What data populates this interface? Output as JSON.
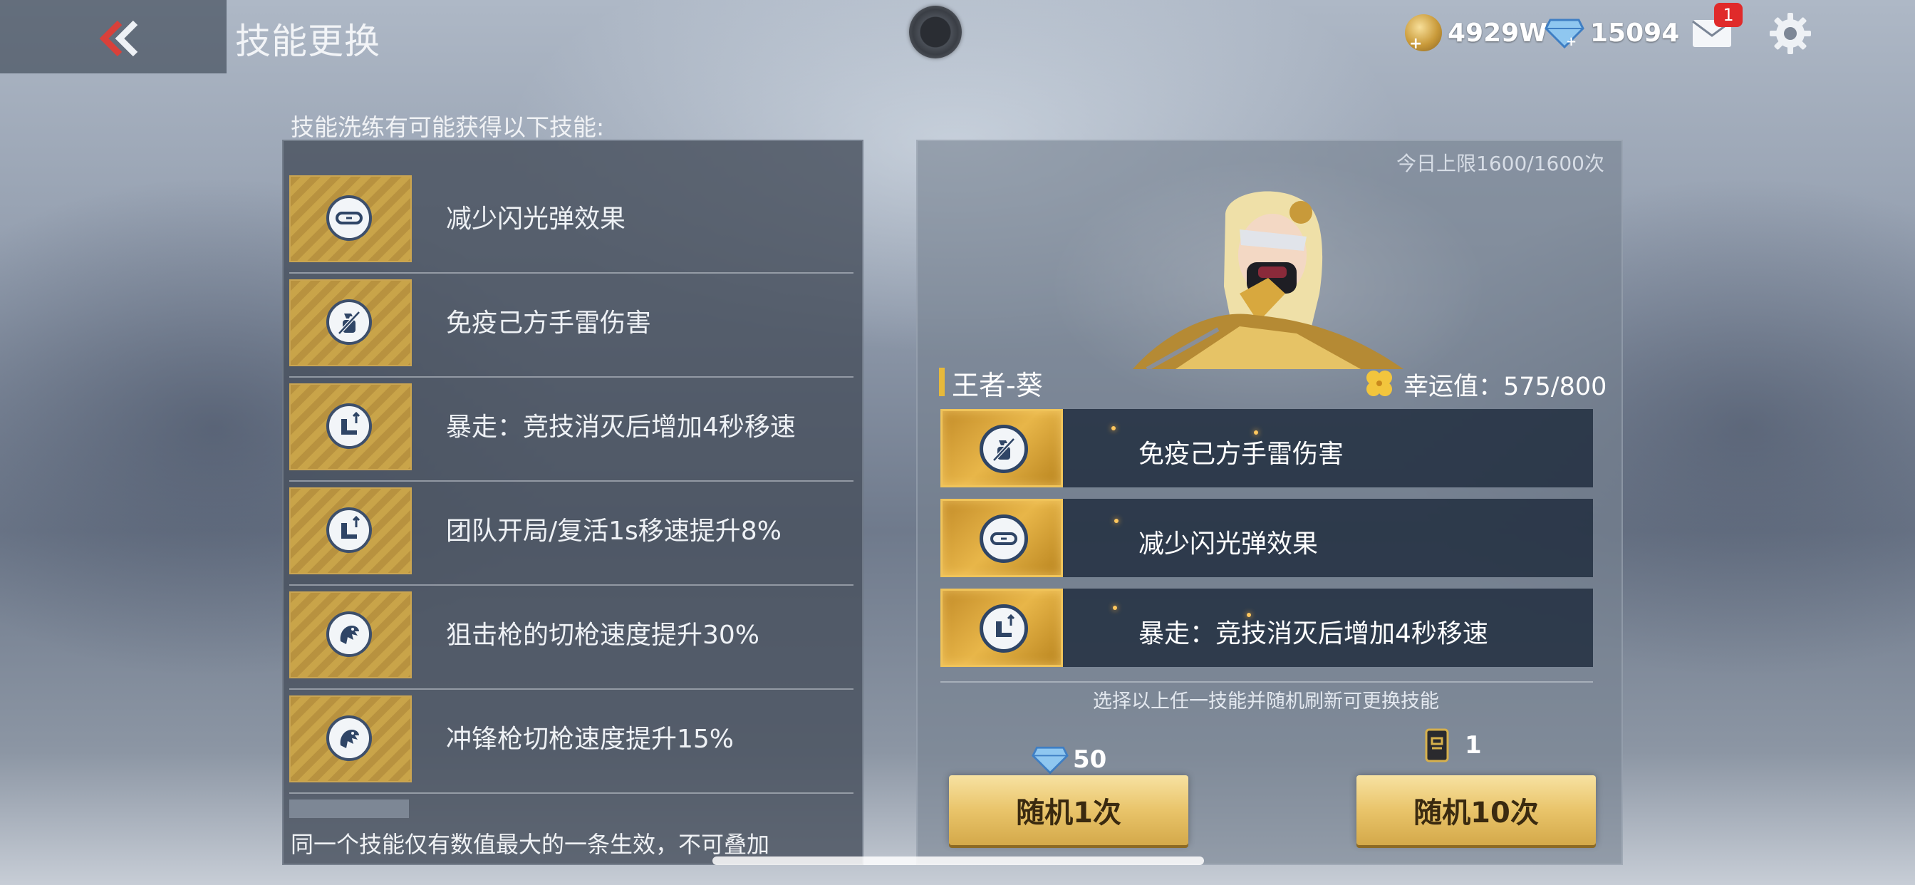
{
  "header": {
    "title": "技能更换",
    "back_icon": "chevron-left-icon",
    "currencies": [
      {
        "name": "gold-coin-icon",
        "value": "4929W"
      },
      {
        "name": "diamond-icon",
        "value": "15094"
      }
    ],
    "mail_badge": "1",
    "accent": "#e7b93a"
  },
  "left": {
    "caption": "技能洗练有可能获得以下技能:",
    "skills": [
      {
        "label": "减少闪光弹效果",
        "icon": "goggles-icon"
      },
      {
        "label": "免疫己方手雷伤害",
        "icon": "grenade-immune-icon"
      },
      {
        "label": "暴走：竞技消灭后增加4秒移速",
        "icon": "boot-speed-icon"
      },
      {
        "label": "团队开局/复活1s移速提升8%",
        "icon": "boot-speed-icon"
      },
      {
        "label": "狙击枪的切枪速度提升30%",
        "icon": "dragon-icon"
      },
      {
        "label": "冲锋枪切枪速度提升15%",
        "icon": "dragon-icon"
      }
    ],
    "footer": "同一个技能仅有数值最大的一条生效，不可叠加"
  },
  "right": {
    "daily_limit": "今日上限1600/1600次",
    "character_name": "王者-葵",
    "luck": "幸运值：575/800",
    "current_skills": [
      {
        "label": "免疫己方手雷伤害",
        "icon": "grenade-immune-icon"
      },
      {
        "label": "减少闪光弹效果",
        "icon": "goggles-icon"
      },
      {
        "label": "暴走：竞技消灭后增加4秒移速",
        "icon": "boot-speed-icon"
      }
    ],
    "hint": "选择以上任一技能并随机刷新可更换技能",
    "cost_once": "50",
    "cost_ten": "1",
    "btn_once": "随机1次",
    "btn_ten": "随机10次"
  }
}
